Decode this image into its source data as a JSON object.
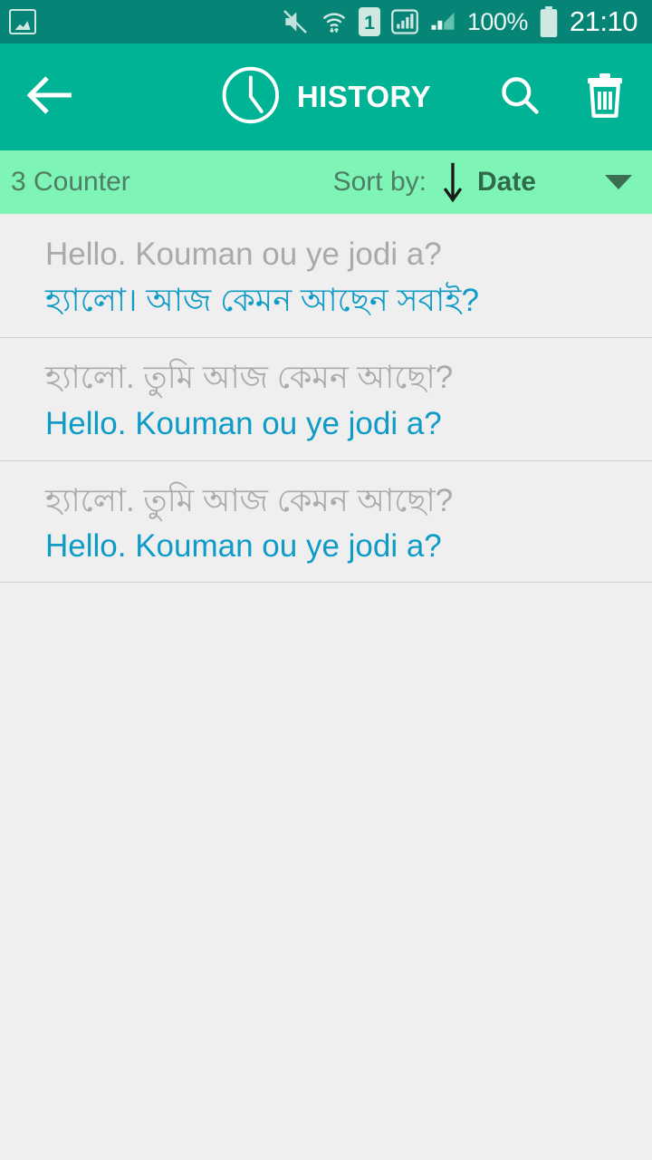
{
  "status_bar": {
    "icons": [
      "gallery-icon",
      "mute-icon",
      "wifi-icon",
      "sim1-icon",
      "signal-icon",
      "signal2-icon"
    ],
    "sim_label": "1",
    "battery_percent": "100%",
    "time": "21:10",
    "background_color": "#068576"
  },
  "app_bar": {
    "back_icon": "arrow-left-icon",
    "clock_icon": "clock-icon",
    "title": "HISTORY",
    "search_icon": "search-icon",
    "delete_icon": "trash-icon",
    "background_color": "#00b394"
  },
  "sort_bar": {
    "counter": "3 Counter",
    "sort_label": "Sort by:",
    "direction_icon": "arrow-down-icon",
    "sort_value": "Date",
    "caret_icon": "chevron-down-icon",
    "background_color": "#7ef5b6"
  },
  "history": {
    "items": [
      {
        "source": "Hello. Kouman ou ye jodi a?",
        "target": "হ্যালো। আজ কেমন আছেন সবাই?"
      },
      {
        "source": "হ্যালো. তুমি আজ কেমন আছো?",
        "target": "Hello. Kouman ou ye jodi a?"
      },
      {
        "source": "হ্যালো. তুমি আজ কেমন আছো?",
        "target": "Hello. Kouman ou ye jodi a?"
      }
    ],
    "source_color": "#aaaaaa",
    "target_color": "#0e9bc8",
    "background_color": "#efefef"
  }
}
